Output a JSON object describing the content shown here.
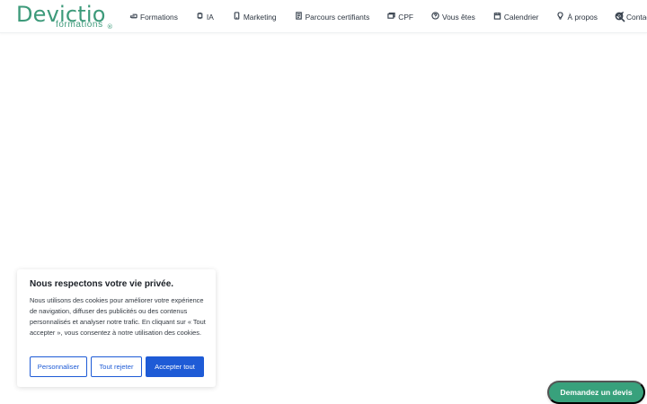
{
  "header": {
    "logo": {
      "name": "Devictio",
      "sub": "formations",
      "reg": "®"
    },
    "nav": [
      {
        "label": "Formations",
        "icon": "hand-point-icon"
      },
      {
        "label": "IA",
        "icon": "chip-icon"
      },
      {
        "label": "Marketing",
        "icon": "phone-icon"
      },
      {
        "label": "Parcours certifiants",
        "icon": "certificate-icon"
      },
      {
        "label": "CPF",
        "icon": "cards-icon"
      },
      {
        "label": "Vous êtes",
        "icon": "question-circle-icon"
      },
      {
        "label": "Calendrier",
        "icon": "calendar-icon"
      },
      {
        "label": "À propos",
        "icon": "lightbulb-icon"
      },
      {
        "label": "Contact",
        "icon": "send-icon"
      }
    ],
    "search_icon": "search-icon"
  },
  "cookie_banner": {
    "title": "Nous respectons votre vie privée.",
    "text": "Nous utilisons des cookies pour améliorer votre expérience de navigation, diffuser des publicités ou des contenus personnalisés et analyser notre trafic. En cliquant sur « Tout accepter », vous consentez à notre utilisation des cookies.",
    "customize_label": "Personnaliser",
    "reject_label": "Tout rejeter",
    "accept_label": "Accepter tout"
  },
  "quote_button": {
    "label": "Demandez un devis"
  },
  "colors": {
    "brand_green": "#3d9a7a",
    "cookie_blue": "#1e5bd6",
    "quote_green": "#38a17c"
  }
}
